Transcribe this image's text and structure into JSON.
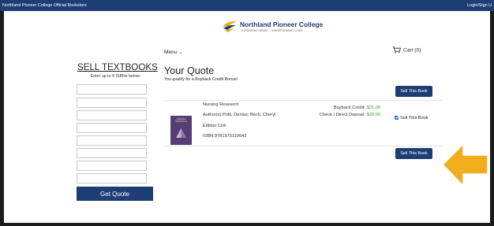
{
  "topbar": {
    "store_name": "Northland Pioneer College Official Bookstore",
    "login": "Login/Sign U"
  },
  "logo": {
    "name": "Northland Pioneer College",
    "tagline": "EXPANDING MINDS - TRANSFORMING LIVES"
  },
  "header": {
    "menu_label": "Menu",
    "cart_label": "Cart (0)"
  },
  "sell_panel": {
    "title": "SELL TEXTBOOKS",
    "subtitle": "Enter up to 8 ISBNs below:",
    "isbn_inputs": [
      "",
      "",
      "",
      "",
      "",
      "",
      "",
      ""
    ],
    "get_quote_label": "Get Quote"
  },
  "quote": {
    "title": "Your Quote",
    "bonus_text": "You qualify for a Buyback Credit Bonus!",
    "sell_button_label": "Sell This Book",
    "book": {
      "cover_title": "NURSING RESEARCH",
      "title": "Nursing Research",
      "authors": "Author(s):Polit, Denise; Beck, Cheryl",
      "edition": "Edition:11th",
      "isbn": "ISBN:9781975110642",
      "buyback_label": "Buyback Credit:",
      "buyback_value": "$21.00",
      "deposit_label": "Check / Direct Deposit:",
      "deposit_value": "$20.00",
      "sell_checkbox_label": "Sell This Book"
    }
  },
  "colors": {
    "brand": "#1e3d75",
    "price_green": "#2c9a2c",
    "arrow": "#f2ad1c",
    "cover": "#553e74"
  }
}
